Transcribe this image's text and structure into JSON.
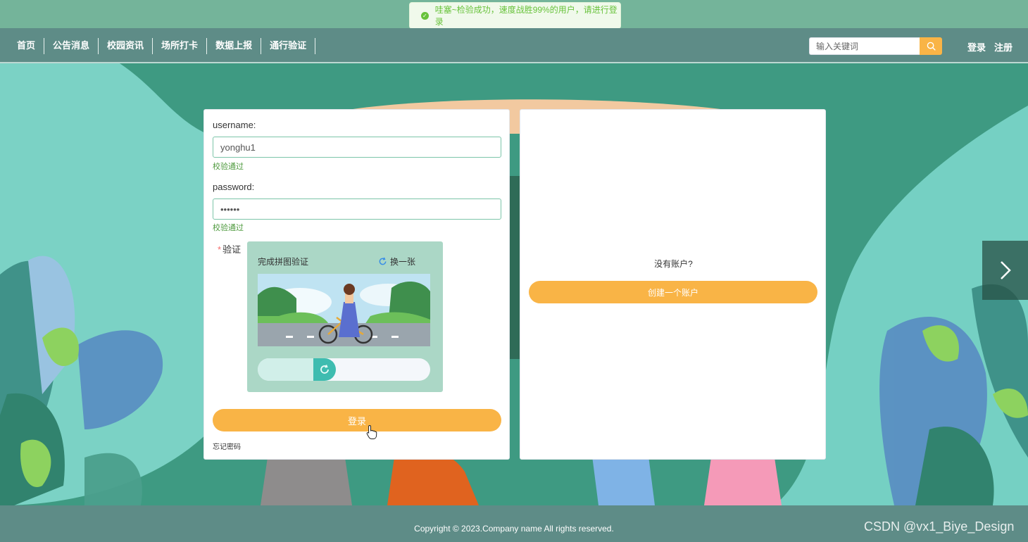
{
  "toast": {
    "message": "哇塞~检验成功，速度战胜99%的用户，请进行登录"
  },
  "nav": {
    "items": [
      "首页",
      "公告消息",
      "校园资讯",
      "场所打卡",
      "数据上报",
      "通行验证"
    ],
    "search_placeholder": "输入关键词",
    "login": "登录",
    "register": "注册"
  },
  "login_form": {
    "username_label": "username:",
    "username_value": "yonghu1",
    "username_hint": "校验通过",
    "password_label": "password:",
    "password_value": "••••••",
    "password_hint": "校验通过",
    "captcha_label": "验证",
    "captcha_required_mark": "*",
    "captcha_title": "完成拼图验证",
    "captcha_refresh": "换一张",
    "slider_progress": 0.37,
    "submit": "登录",
    "forgot": "忘记密码"
  },
  "register_panel": {
    "prompt": "没有账户?",
    "create": "创建一个账户"
  },
  "footer": {
    "copyright": "Copyright © 2023.Company name All rights reserved.",
    "watermark": "CSDN @vx1_Biye_Design"
  },
  "colors": {
    "nav_bg": "#5e8c87",
    "accent_orange": "#f9b446",
    "success_green": "#67c23a",
    "hint_green": "#4e9a3e",
    "captcha_bg": "#abd7c6",
    "slider_handle": "#3ebcb0"
  },
  "icons": [
    "check-circle-icon",
    "search-icon",
    "refresh-icon",
    "chevron-right-icon",
    "pointer-hand-icon"
  ]
}
